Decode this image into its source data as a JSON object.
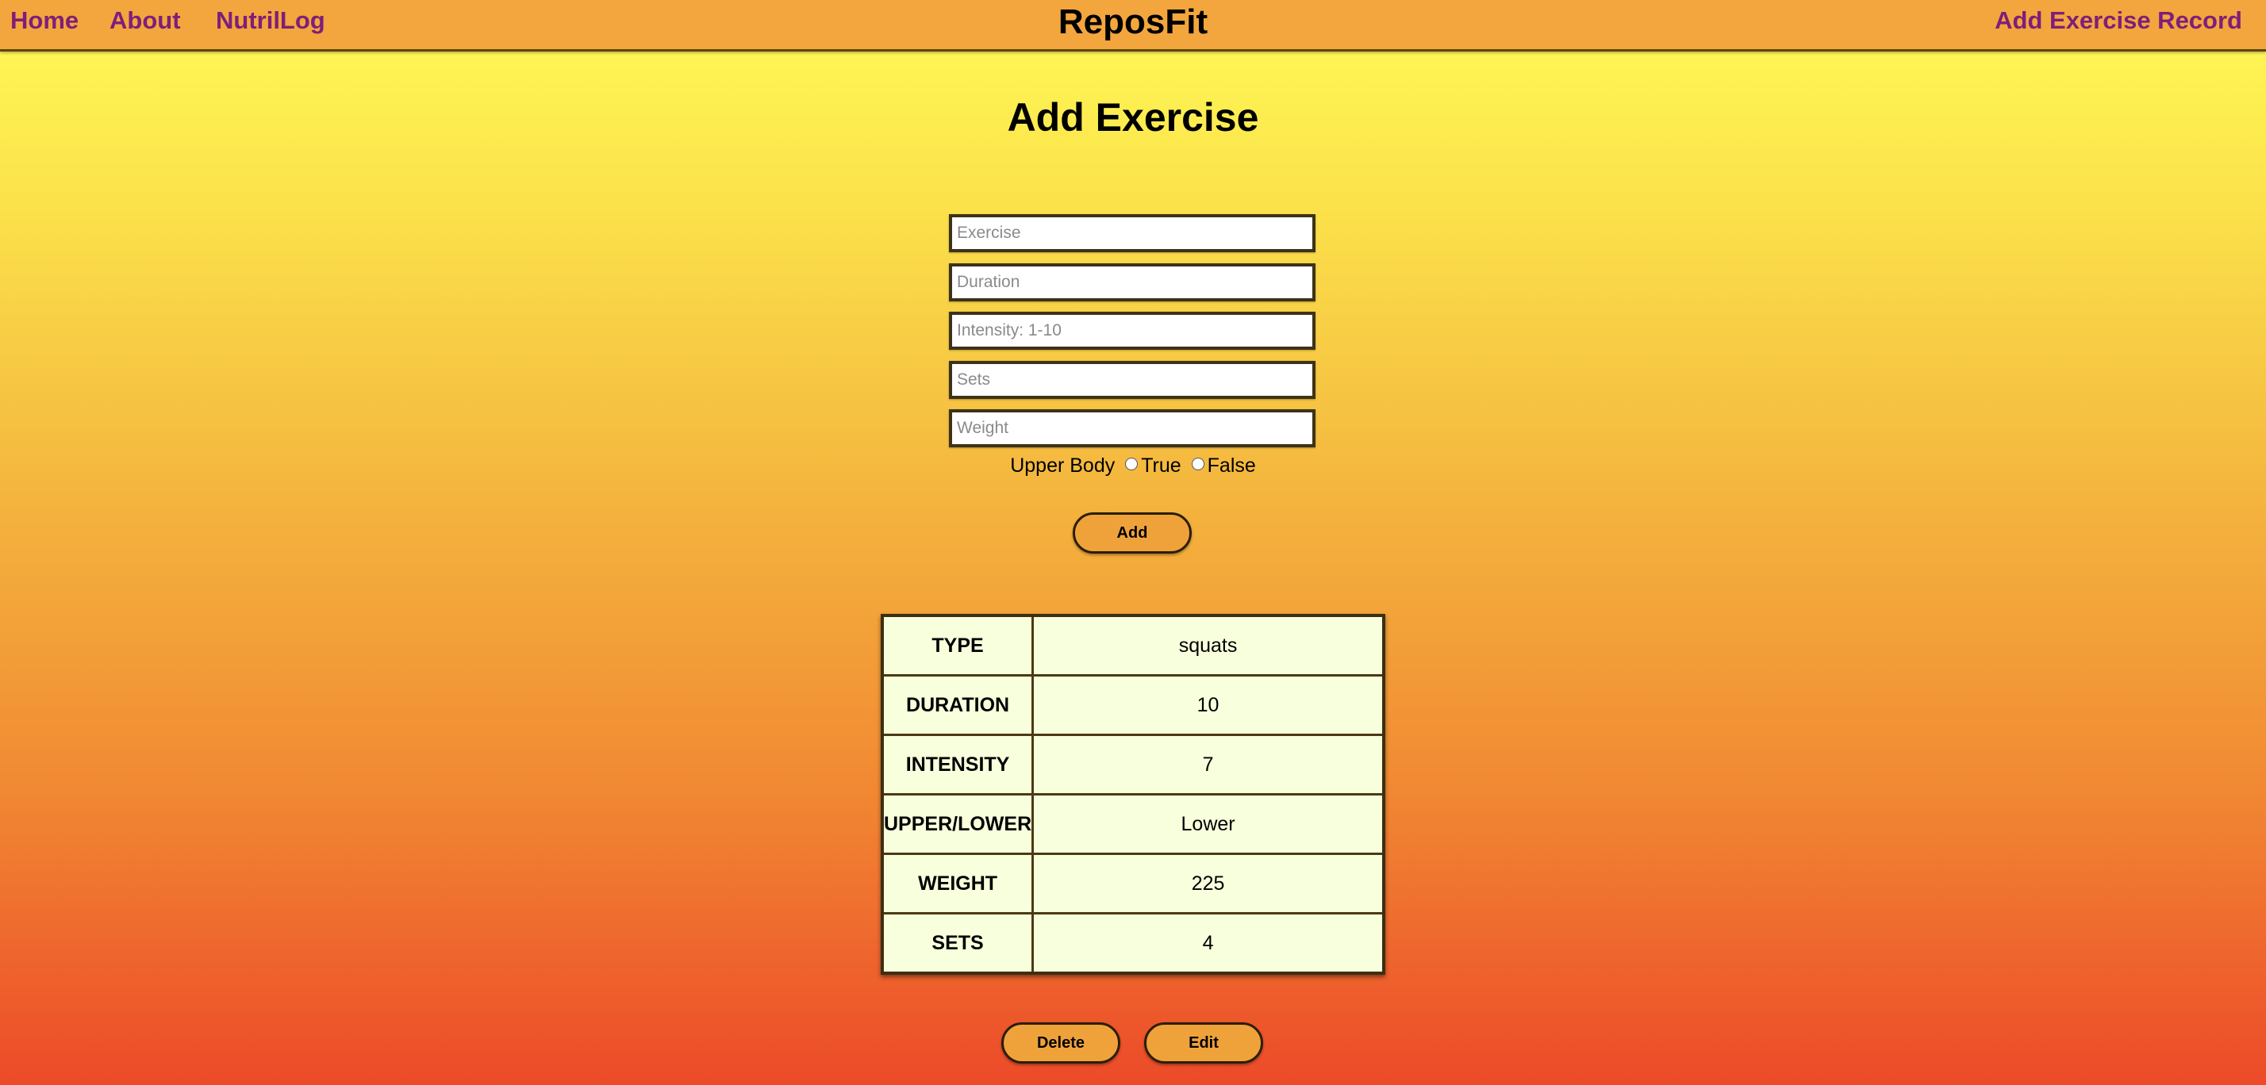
{
  "navbar": {
    "links": {
      "home": "Home",
      "about": "About",
      "nutrilog": "NutrilLog",
      "add_record": "Add Exercise Record"
    },
    "brand": "ReposFit"
  },
  "page": {
    "title": "Add Exercise"
  },
  "form": {
    "exercise_placeholder": "Exercise",
    "duration_placeholder": "Duration",
    "intensity_placeholder": "Intensity: 1-10",
    "sets_placeholder": "Sets",
    "weight_placeholder": "Weight",
    "upper_body_label": "Upper Body",
    "true_label": "True",
    "false_label": "False",
    "add_button": "Add"
  },
  "record": {
    "rows": [
      {
        "key": "TYPE",
        "value": "squats"
      },
      {
        "key": "DURATION",
        "value": "10"
      },
      {
        "key": "INTENSITY",
        "value": "7"
      },
      {
        "key": "UPPER/LOWER",
        "value": "Lower"
      },
      {
        "key": "WEIGHT",
        "value": "225"
      },
      {
        "key": "SETS",
        "value": "4"
      }
    ],
    "delete_button": "Delete",
    "edit_button": "Edit"
  },
  "colors": {
    "navbar_bg": "#f2a63d",
    "link_color": "#7f1e7a",
    "gradient_top": "#fffb57",
    "gradient_bottom": "#ec4a29",
    "button_bg": "#f0a23a",
    "table_bg": "#f8ffdc"
  }
}
